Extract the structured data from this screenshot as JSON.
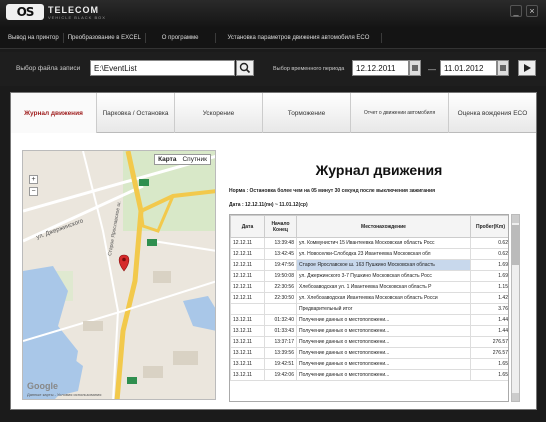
{
  "app": {
    "logo_mark": "OS",
    "logo_name": "TELECOM",
    "logo_sub": "VEHICLE BLACK BOX"
  },
  "menu": [
    "Вывод на принтор",
    "Преобразование в EXCEL",
    "О программе",
    "Установка параметров движения автомобиля ECO"
  ],
  "file": {
    "label": "Выбор файла записи",
    "path": "E:\\EventList"
  },
  "period": {
    "label": "Выбор временного периода",
    "start": "12.12.2011",
    "dash": "—",
    "end": "11.01.2012"
  },
  "tabs": [
    "Журнал движения",
    "Парковка / Остановка",
    "Ускорение",
    "Торможение",
    "Отчет о движении автомобиля",
    "Оценка вождения ECO"
  ],
  "map": {
    "tab_map": "Карта",
    "tab_sat": "Спутник",
    "zoom_in": "+",
    "zoom_out": "−",
    "google": "Google",
    "footer": "Данные карты - Условия использования",
    "street1": "ул. Джержинского",
    "street2": "Старое Ярославское ш."
  },
  "journal": {
    "title": "Журнал движения",
    "note": "Норма : Остановка более чем на 05 минут 30 секунд после выключения зажигания",
    "date": "Дата : 12.12.11(пн) ~ 11.01.12(ср)",
    "headers": [
      "Дата",
      "Начало\nКонец",
      "Местонахождение",
      "Пробег(Km)"
    ],
    "rows": [
      [
        "12.12.11",
        "13:39:48",
        "ул. Коммунистич 15 Ивантеевка Московская область Росс",
        "0.62"
      ],
      [
        "12.12.11",
        "13:42:45",
        "ул. Новоселки-Слободка 23 Ивантеевка Московская обл",
        "0.62"
      ],
      [
        "12.12.11",
        "19:47:56",
        "Старое Ярославское ш. 163 Пушкино Московская область",
        "1.69"
      ],
      [
        "12.12.11",
        "19:50:08",
        "ул. Джержинского 3-7 Пушкино Московская область Росс",
        "1.69"
      ],
      [
        "12.12.11",
        "22:30:56",
        "Хлебозаводская ул. 1 Ивантеевка Московская область Р",
        "1.15"
      ],
      [
        "12.12.11",
        "22:30:50",
        "ул. Хлебозаводская Ивантеевка Московская область Росси",
        "1.42"
      ],
      [
        "",
        "",
        "Предварительный итог",
        "3.76"
      ],
      [
        "13.12.11",
        "01:32:40",
        "Получение данных о местоположени...",
        "1.44"
      ],
      [
        "13.12.11",
        "01:33:43",
        "Получение данных о местоположени...",
        "1.44"
      ],
      [
        "13.12.11",
        "13:37:17",
        "Получение данных о местоположени...",
        "276.57"
      ],
      [
        "13.12.11",
        "13:39:56",
        "Получение данных о местоположени...",
        "276.57"
      ],
      [
        "13.12.11",
        "19:42:51",
        "Получение данных о местоположени...",
        "1.65"
      ],
      [
        "13.12.11",
        "19:42:06",
        "Получение данных о местоположени...",
        "1.65"
      ]
    ]
  },
  "colors": {
    "accent_tab": "#a02020",
    "selected_row": "#c8d8ec"
  }
}
